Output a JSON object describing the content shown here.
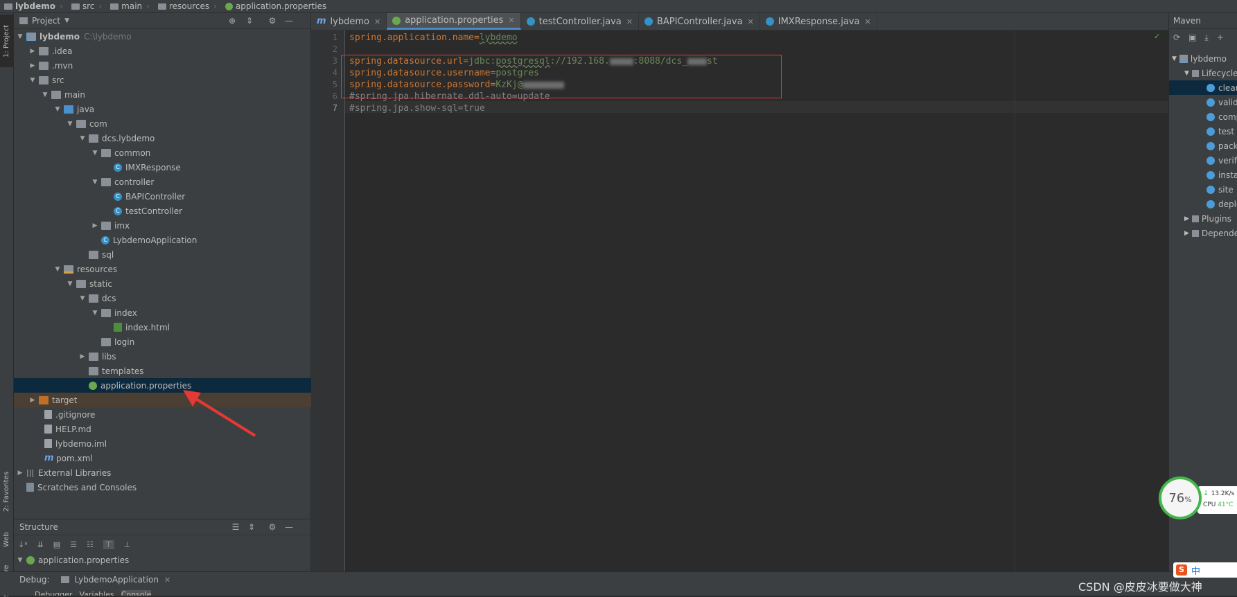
{
  "breadcrumb": [
    "lybdemo",
    "src",
    "main",
    "resources",
    "application.properties"
  ],
  "left_stripe": {
    "project_tab": "1: Project",
    "favorites_tab": "2: Favorites",
    "web_tab": "Web",
    "structure_tab": "Structure"
  },
  "project_panel": {
    "title": "Project",
    "tree": [
      {
        "label": "lybdemo",
        "sub": "C:\\lybdemo"
      },
      {
        "label": ".idea"
      },
      {
        "label": ".mvn"
      },
      {
        "label": "src"
      },
      {
        "label": "main"
      },
      {
        "label": "java"
      },
      {
        "label": "com"
      },
      {
        "label": "dcs.lybdemo"
      },
      {
        "label": "common"
      },
      {
        "label": "IMXResponse"
      },
      {
        "label": "controller"
      },
      {
        "label": "BAPIController"
      },
      {
        "label": "testController"
      },
      {
        "label": "imx"
      },
      {
        "label": "LybdemoApplication"
      },
      {
        "label": "sql"
      },
      {
        "label": "resources"
      },
      {
        "label": "static"
      },
      {
        "label": "dcs"
      },
      {
        "label": "index"
      },
      {
        "label": "index.html"
      },
      {
        "label": "login"
      },
      {
        "label": "libs"
      },
      {
        "label": "templates"
      },
      {
        "label": "application.properties"
      },
      {
        "label": "target"
      },
      {
        "label": ".gitignore"
      },
      {
        "label": "HELP.md"
      },
      {
        "label": "lybdemo.iml"
      },
      {
        "label": "pom.xml"
      },
      {
        "label": "External Libraries"
      },
      {
        "label": "Scratches and Consoles"
      }
    ]
  },
  "structure_panel": {
    "title": "Structure",
    "root": "application.properties"
  },
  "editor": {
    "tabs": [
      "lybdemo",
      "application.properties",
      "testController.java",
      "BAPIController.java",
      "IMXResponse.java"
    ],
    "active_tab": "application.properties",
    "line_numbers": [
      "1",
      "2",
      "3",
      "4",
      "5",
      "6",
      "7"
    ],
    "lines": {
      "l1_key": "spring.application.name",
      "l1_val": "lybdemo",
      "l3_key": "spring.datasource.url",
      "l3_val_a": "jdbc:",
      "l3_val_b": "postgresql",
      "l3_val_c": "://192.168.",
      "l3_val_d": ":8088/dcs_",
      "l3_val_e": "st",
      "l4_key": "spring.datasource.username",
      "l4_val": "postgres",
      "l5_key": "spring.datasource.password",
      "l5_val": "KzKj@",
      "l6": "#spring.jpa.hibernate.ddl-auto=update",
      "l7": "#spring.jpa.show-sql=true"
    }
  },
  "maven_panel": {
    "title": "Maven",
    "items": [
      "lybdemo",
      "Lifecycle",
      "clean",
      "valida",
      "comp",
      "test",
      "packa",
      "verify",
      "instal",
      "site",
      "deplo",
      "Plugins",
      "Depende"
    ]
  },
  "debug_bar": {
    "label": "Debug:",
    "config": "LybdemoApplication",
    "tabs": [
      "Debugger",
      "Variables",
      "Console"
    ]
  },
  "system_widget": {
    "percent": "76",
    "percent_sign": "%",
    "net_speed": "13.2K/s",
    "cpu_label": "CPU",
    "cpu_temp": "41°C"
  },
  "watermark": "CSDN @皮皮冰要做大神",
  "colors": {
    "selection": "#0d293e",
    "accent": "#4a88c7",
    "annotation_red": "#e53935"
  }
}
